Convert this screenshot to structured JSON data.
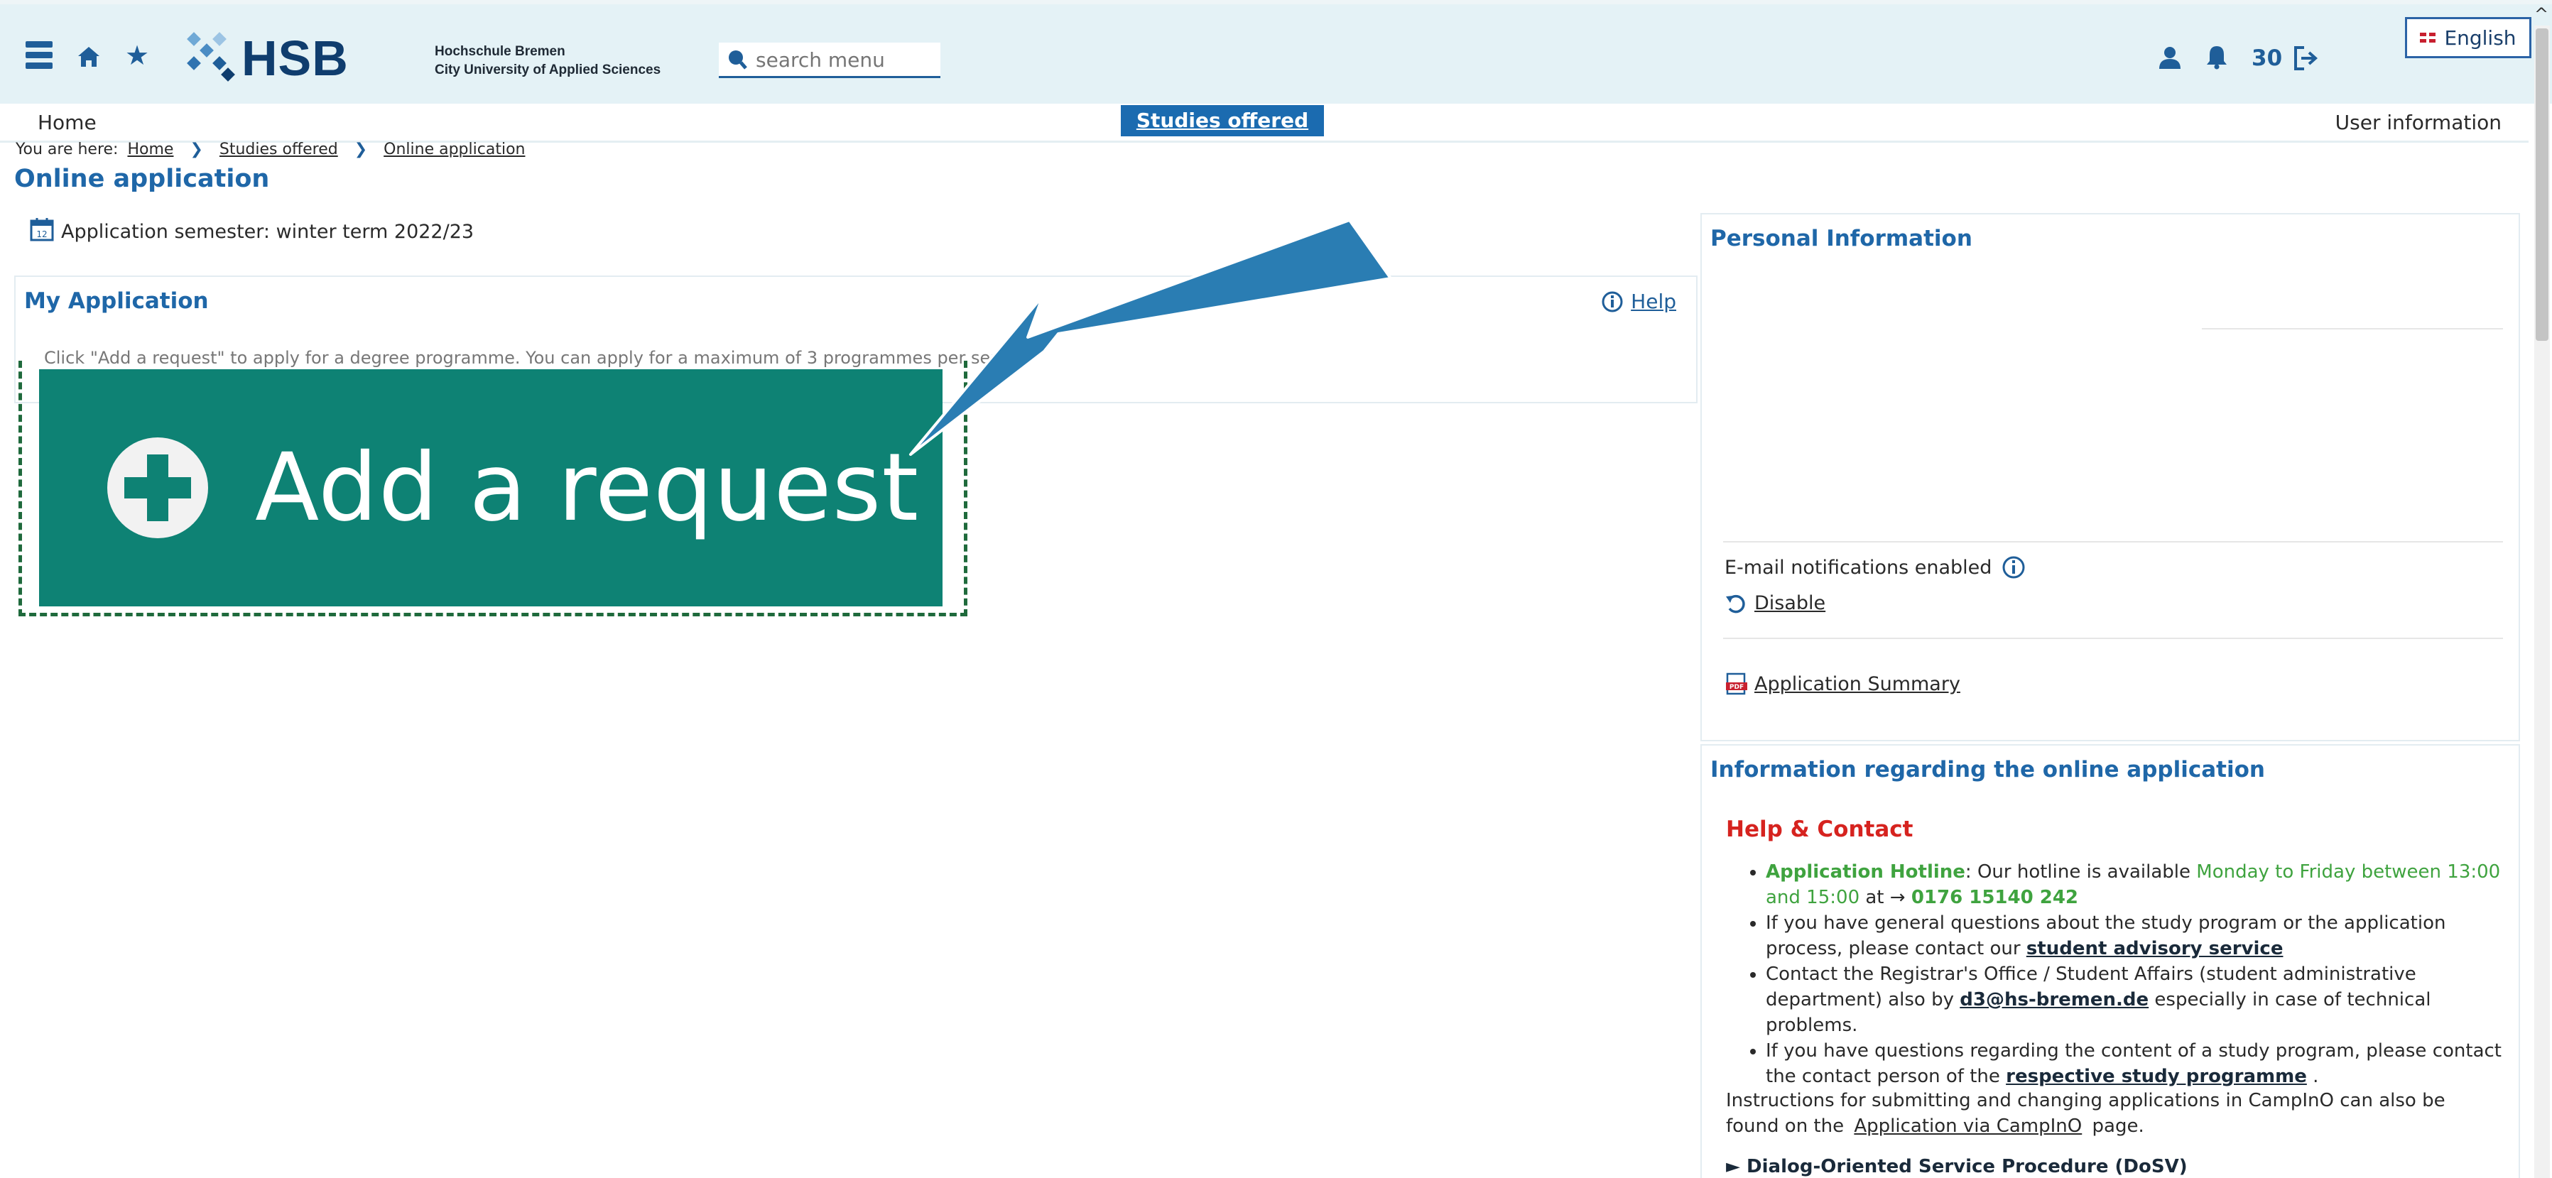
{
  "header": {
    "brand": "HSB",
    "university_line1": "Hochschule Bremen",
    "university_line2": "City University of Applied Sciences",
    "search_placeholder": "search menu",
    "notification_count": "30",
    "language": "English"
  },
  "nav": {
    "home": "Home",
    "studies_offered": "Studies offered",
    "user_information": "User information"
  },
  "breadcrumb": {
    "prefix": "You are here:",
    "items": [
      "Home",
      "Studies offered",
      "Online application"
    ]
  },
  "page_title": "Online application",
  "semester": "Application semester: winter term 2022/23",
  "my_application": {
    "title": "My Application",
    "help": "Help",
    "hint": "Click \"Add a request\" to apply for a degree programme. You can apply for a maximum of 3 programmes per semester, including the Numerus clausus..."
  },
  "callout": {
    "button_label": "Add a request"
  },
  "personal_information": {
    "title": "Personal Information",
    "email_notifications": "E-mail notifications enabled",
    "disable": "Disable",
    "application_summary": "Application Summary"
  },
  "info_panel": {
    "title": "Information regarding the online application",
    "help_contact": "Help & Contact",
    "hotline_label": "Application Hotline",
    "hotline_text": ": Our hotline is available ",
    "hotline_hours": "Monday to Friday between 13:00 and 15:00",
    "hotline_at": " at → ",
    "hotline_number": "0176 15140 242",
    "item2_text": "If you have general questions about the study program or the application process, please contact our ",
    "item2_link": "student advisory service",
    "item3_text": "Contact the Registrar's Office / Student Affairs (student administrative department) also by ",
    "item3_link": "d3@hs-bremen.de",
    "item3_tail": " especially in case of technical problems.",
    "item4_text": "If you have questions regarding the content of a study program, please contact the contact person of the ",
    "item4_link": "respective study programme",
    "item4_tail": " .",
    "instructions_text": "Instructions for submitting and changing applications in CampInO can also be found on the",
    "instructions_link": "Application via CampInO",
    "instructions_tail": "page.",
    "dosv": "► Dialog-Oriented Service Procedure (DoSV)"
  },
  "colors": {
    "header_bg": "#e4f2f6",
    "brand_blue": "#1f67a8",
    "nav_active": "#1b6bb0",
    "add_request_bg": "#0e8274",
    "arrow": "#2a7db3",
    "help_contact": "#d6231f",
    "hotline_green": "#3fa33f"
  },
  "icons": [
    "hamburger-menu-icon",
    "home-icon",
    "star-icon",
    "hsb-logo-icon",
    "search-icon",
    "user-icon",
    "bell-icon",
    "logout-icon",
    "flag-icon",
    "calendar-icon",
    "info-icon",
    "refresh-icon",
    "pdf-icon",
    "plus-circle-icon",
    "arrow-pointer-icon"
  ]
}
